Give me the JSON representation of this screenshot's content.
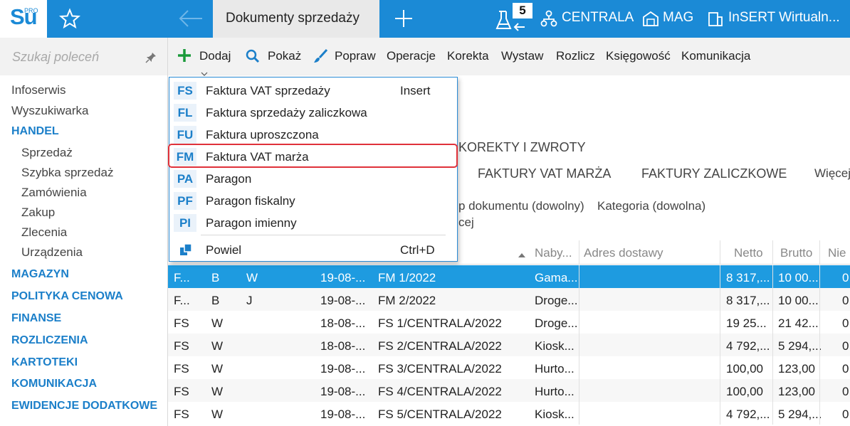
{
  "topbar": {
    "logo_text": "Su",
    "logo_sup": "PRO",
    "tab_title": "Dokumenty sprzedaży",
    "notification_count": "5",
    "items": [
      "CENTRALA",
      "MAG",
      "InSERT Wirtualn..."
    ]
  },
  "sidebar": {
    "search_placeholder": "Szukaj poleceń",
    "items": [
      {
        "label": "Infoserwis",
        "type": "item"
      },
      {
        "label": "Wyszukiwarka",
        "type": "item"
      },
      {
        "label": "HANDEL",
        "type": "head"
      },
      {
        "label": "Sprzedaż",
        "type": "sub"
      },
      {
        "label": "Szybka sprzedaż",
        "type": "sub"
      },
      {
        "label": "Zamówienia",
        "type": "sub"
      },
      {
        "label": "Zakup",
        "type": "sub"
      },
      {
        "label": "Zlecenia",
        "type": "sub"
      },
      {
        "label": "Urządzenia",
        "type": "sub"
      },
      {
        "label": "MAGAZYN",
        "type": "head"
      },
      {
        "label": "POLITYKA CENOWA",
        "type": "head"
      },
      {
        "label": "FINANSE",
        "type": "head"
      },
      {
        "label": "ROZLICZENIA",
        "type": "head"
      },
      {
        "label": "KARTOTEKI",
        "type": "head"
      },
      {
        "label": "KOMUNIKACJA",
        "type": "head"
      },
      {
        "label": "EWIDENCJE DODATKOWE",
        "type": "head"
      }
    ]
  },
  "toolbar": {
    "dodaj": "Dodaj",
    "pokaz": "Pokaż",
    "popraw": "Popraw",
    "operacje": "Operacje",
    "korekta": "Korekta",
    "wystaw": "Wystaw",
    "rozlicz": "Rozlicz",
    "ksiegowosc": "Księgowość",
    "komunikacja": "Komunikacja"
  },
  "content": {
    "section_title": "KOREKTY I ZWROTY",
    "subtabs": [
      "FAKTURY VAT MARŻA",
      "FAKTURY ZALICZKOWE",
      "Więcej"
    ],
    "filter_type": "p dokumentu (dowolny)",
    "filter_category": "Kategoria (dowolna)",
    "filter_more": "cej"
  },
  "grid": {
    "headers": {
      "nabywca": "Naby...",
      "adres": "Adres dostawy",
      "netto": "Netto",
      "brutto": "Brutto",
      "nie": "Nie"
    },
    "rows": [
      {
        "c1": "F...",
        "c2": "B",
        "c3": "W",
        "date": "19-08-...",
        "num": "FM 1/2022",
        "buyer": "Gama...",
        "netto": "8 317,...",
        "brutto": "10 00...",
        "last": "0",
        "selected": true
      },
      {
        "c1": "F...",
        "c2": "B",
        "c3": "J",
        "date": "19-08-...",
        "num": "FM 2/2022",
        "buyer": "Droge...",
        "netto": "8 317,...",
        "brutto": "10 00...",
        "last": "0"
      },
      {
        "c1": "FS",
        "c2": "W",
        "c3": "",
        "date": "18-08-...",
        "num": "FS 1/CENTRALA/2022",
        "buyer": "Droge...",
        "netto": "19 25...",
        "brutto": "21 42...",
        "last": "0"
      },
      {
        "c1": "FS",
        "c2": "W",
        "c3": "",
        "date": "18-08-...",
        "num": "FS 2/CENTRALA/2022",
        "buyer": "Kiosk...",
        "netto": "4 792,...",
        "brutto": "5 294,...",
        "last": "0"
      },
      {
        "c1": "FS",
        "c2": "W",
        "c3": "",
        "date": "19-08-...",
        "num": "FS 3/CENTRALA/2022",
        "buyer": "Hurto...",
        "netto": "100,00",
        "brutto": "123,00",
        "last": "0"
      },
      {
        "c1": "FS",
        "c2": "W",
        "c3": "",
        "date": "19-08-...",
        "num": "FS 4/CENTRALA/2022",
        "buyer": "Hurto...",
        "netto": "100,00",
        "brutto": "123,00",
        "last": "0"
      },
      {
        "c1": "FS",
        "c2": "W",
        "c3": "",
        "date": "19-08-...",
        "num": "FS 5/CENTRALA/2022",
        "buyer": "Kiosk...",
        "netto": "4 792,...",
        "brutto": "5 294,...",
        "last": "0"
      }
    ]
  },
  "menu": {
    "items": [
      {
        "code": "FS",
        "label": "Faktura VAT sprzedaży",
        "shortcut": "Insert"
      },
      {
        "code": "FL",
        "label": "Faktura sprzedaży zaliczkowa",
        "shortcut": ""
      },
      {
        "code": "FU",
        "label": "Faktura uproszczona",
        "shortcut": ""
      },
      {
        "code": "FM",
        "label": "Faktura VAT marża",
        "shortcut": ""
      },
      {
        "code": "PA",
        "label": "Paragon",
        "shortcut": ""
      },
      {
        "code": "PF",
        "label": "Paragon fiskalny",
        "shortcut": ""
      },
      {
        "code": "PI",
        "label": "Paragon imienny",
        "shortcut": ""
      }
    ],
    "powiel_label": "Powiel",
    "powiel_shortcut": "Ctrl+D"
  },
  "colors": {
    "accent": "#1b8ad6",
    "selected_row": "#1e9be0",
    "highlight": "#e0313a"
  }
}
